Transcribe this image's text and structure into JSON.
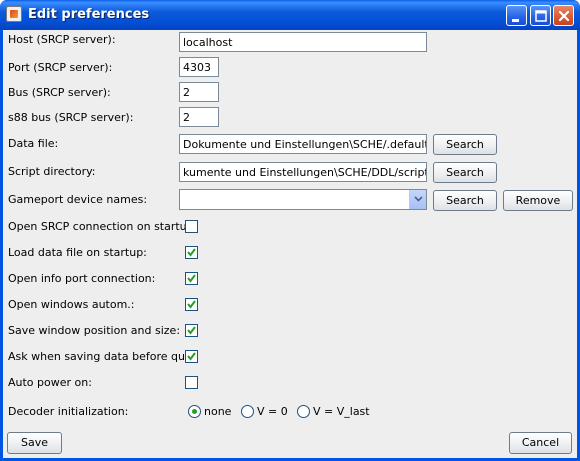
{
  "window": {
    "title": "Edit preferences"
  },
  "fields": {
    "host_label": "Host (SRCP server):",
    "host_value": "localhost",
    "port_label": "Port (SRCP server):",
    "port_value": "4303",
    "bus_label": "Bus (SRCP server):",
    "bus_value": "2",
    "s88_label": "s88 bus (SRCP server):",
    "s88_value": "2",
    "datafile_label": "Data file:",
    "datafile_value": "Dokumente und Einstellungen\\SCHE/.default.jman",
    "datafile_button": "Search",
    "scriptdir_label": "Script directory:",
    "scriptdir_value": "kumente und Einstellungen\\SCHE/DDL/scripts/rcsh",
    "scriptdir_button": "Search",
    "gameport_label": "Gameport device names:",
    "gameport_value": "",
    "gameport_search": "Search",
    "gameport_remove": "Remove"
  },
  "options": {
    "open_srcp_label": "Open SRCP connection on startup:",
    "open_srcp_checked": false,
    "load_data_label": "Load data file on startup:",
    "load_data_checked": true,
    "open_info_label": "Open info port connection:",
    "open_info_checked": true,
    "open_windows_label": "Open windows autom.:",
    "open_windows_checked": true,
    "save_window_label": "Save window position and size:",
    "save_window_checked": true,
    "ask_saving_label": "Ask when saving data before quit:",
    "ask_saving_checked": true,
    "auto_power_label": "Auto power on:",
    "auto_power_checked": false
  },
  "decoder": {
    "label": "Decoder initialization:",
    "opt_none": "none",
    "opt_zero": "V = 0",
    "opt_last": "V = V_last",
    "selected": "none"
  },
  "footer": {
    "save": "Save",
    "cancel": "Cancel"
  },
  "colors": {
    "titlebar": "#0054e3",
    "check": "#21a121"
  }
}
